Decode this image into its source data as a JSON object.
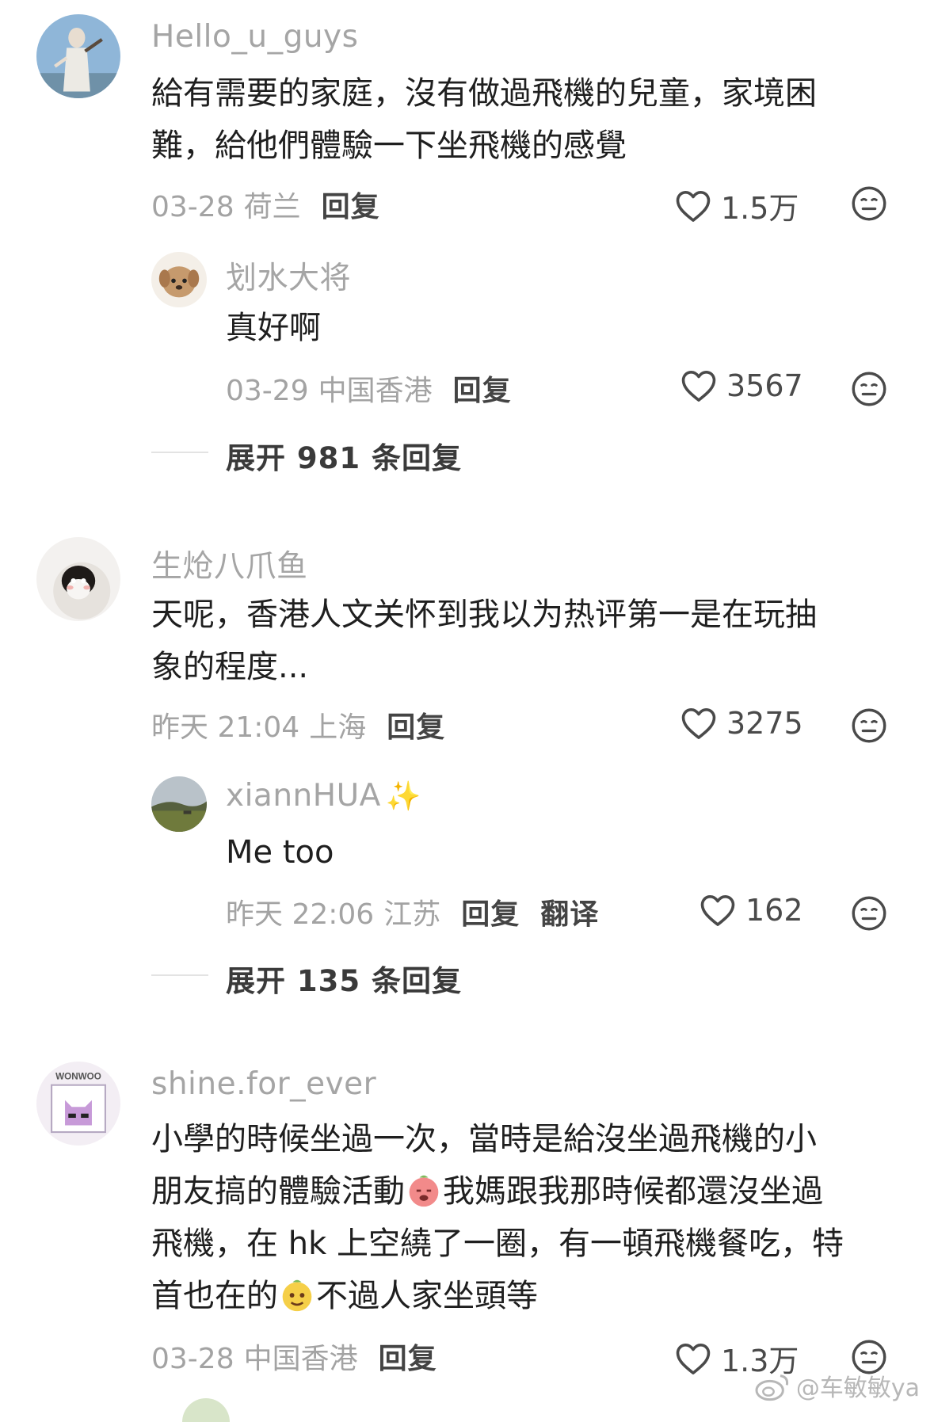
{
  "comments": [
    {
      "username": "Hello_u_guys",
      "text_lines": [
        "給有需要的家庭，沒有做過飛機的兒童，家境困",
        "難，給他們體驗一下坐飛機的感覺"
      ],
      "date": "03-28",
      "location": "荷兰",
      "reply_label": "回复",
      "likes": "1.5万",
      "replies": [
        {
          "username": "划水大将",
          "text": "真好啊",
          "date": "03-29",
          "location": "中国香港",
          "reply_label": "回复",
          "likes": "3567"
        }
      ],
      "expand_label": "展开 981 条回复"
    },
    {
      "username": "生炝八爪鱼",
      "text_lines": [
        "天呢，香港人文关怀到我以为热评第一是在玩抽",
        "象的程度..."
      ],
      "date": "昨天 21:04",
      "location": "上海",
      "reply_label": "回复",
      "likes": "3275",
      "replies": [
        {
          "username": "xiannHUA",
          "username_sparkle": "✨",
          "text": "Me too",
          "date": "昨天 22:06",
          "location": "江苏",
          "reply_label": "回复",
          "translate_label": "翻译",
          "likes": "162"
        }
      ],
      "expand_label": "展开 135 条回复"
    },
    {
      "username": "shine.for_ever",
      "avatar_text": "WONWOO",
      "text_lines": [
        "小學的時候坐過一次，當時是給沒坐過飛機的小",
        "朋友搞的體驗活動",
        "我媽跟我那時候都還沒坐過",
        "飛機，在 hk 上空繞了一圈，有一頓飛機餐吃，特",
        "首也在的",
        "不過人家坐頭等"
      ],
      "date": "03-28",
      "location": "中国香港",
      "reply_label": "回复",
      "likes": "1.3万"
    }
  ],
  "watermark": "@车敏敏ya",
  "colors": {
    "username": "#a5a5a5",
    "text": "#1f1f1f",
    "meta": "#a3a3a3",
    "action": "#444444"
  },
  "icons": {
    "like": "heart-outline-icon",
    "dislike": "meh-face-icon",
    "weibo": "weibo-logo-icon"
  }
}
